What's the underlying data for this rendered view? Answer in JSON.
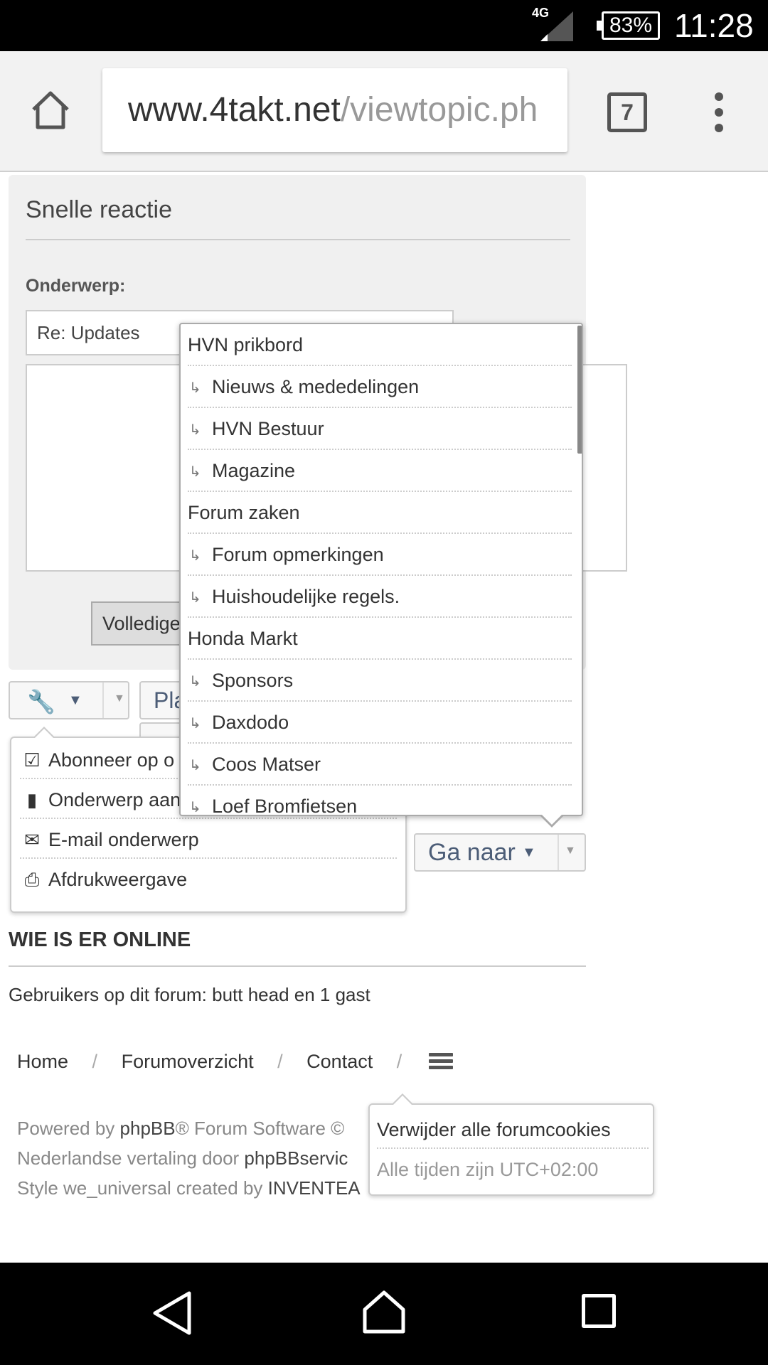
{
  "status_bar": {
    "network": "4G",
    "battery": "83%",
    "time": "11:28"
  },
  "browser": {
    "url_domain": "www.4takt.net",
    "url_path": "/viewtopic.ph",
    "tab_count": "7"
  },
  "quick_reply": {
    "title": "Snelle reactie",
    "subject_label": "Onderwerp:",
    "subject_value": "Re: Updates",
    "full_editor_button": "Volledige"
  },
  "post_button_label": "Pla",
  "tools_menu": {
    "items": [
      {
        "icon": "checkbox-icon",
        "label": "Abonneer op o"
      },
      {
        "icon": "bookmark-icon",
        "label": "Onderwerp aan"
      },
      {
        "icon": "envelope-icon",
        "label": "E-mail onderwerp"
      },
      {
        "icon": "printer-icon",
        "label": "Afdrukweergave"
      }
    ]
  },
  "jump_to": {
    "button_label": "Ga naar",
    "items": [
      {
        "label": "HVN prikbord",
        "sub": false
      },
      {
        "label": "Nieuws & mededelingen",
        "sub": true
      },
      {
        "label": "HVN Bestuur",
        "sub": true
      },
      {
        "label": "Magazine",
        "sub": true
      },
      {
        "label": "Forum zaken",
        "sub": false
      },
      {
        "label": "Forum opmerkingen",
        "sub": true
      },
      {
        "label": "Huishoudelijke regels.",
        "sub": true
      },
      {
        "label": "Honda Markt",
        "sub": false
      },
      {
        "label": "Sponsors",
        "sub": true
      },
      {
        "label": "Daxdodo",
        "sub": true
      },
      {
        "label": "Coos Matser",
        "sub": true
      },
      {
        "label": "Loef Bromfietsen",
        "sub": true
      }
    ]
  },
  "online": {
    "title": "WIE IS ER ONLINE",
    "text": "Gebruikers op dit forum: butt head en 1 gast"
  },
  "footer": {
    "nav": [
      "Home",
      "Forumoverzicht",
      "Contact"
    ],
    "separator": "/",
    "credits": [
      {
        "prefix": "Powered by ",
        "link": "phpBB",
        "suffix": "® Forum Software ©"
      },
      {
        "prefix": "Nederlandse vertaling door ",
        "link": "phpBBservic",
        "suffix": ""
      },
      {
        "prefix": "Style we_universal created by ",
        "link": "INVENTEA",
        "suffix": ""
      }
    ]
  },
  "cookie_popup": {
    "delete_cookies": "Verwijder alle forumcookies",
    "timezone": "Alle tijden zijn UTC+02:00"
  }
}
